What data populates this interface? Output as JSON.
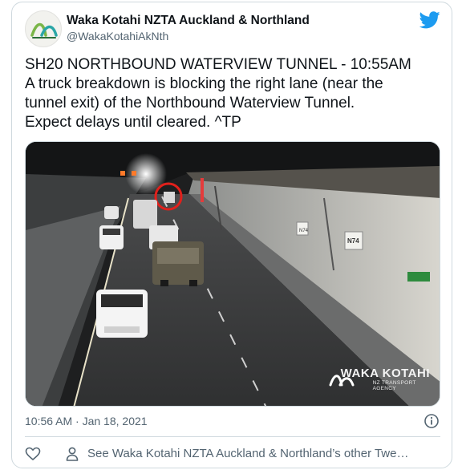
{
  "author": {
    "name": "Waka Kotahi NZTA Auckland & Northland",
    "handle": "@WakaKotahiAkNth",
    "avatar_icon": "waka-kotahi-logo"
  },
  "platform_icon": "twitter-bird-icon",
  "tweet": {
    "text_lines": [
      "SH20 NORTHBOUND WATERVIEW TUNNEL - 10:55AM",
      "A truck breakdown is blocking the right lane (near the",
      "tunnel exit) of the Northbound Waterview Tunnel.",
      "Expect delays until cleared. ^TP"
    ]
  },
  "media": {
    "watermark_main": "WAKA KOTAHI",
    "watermark_sub_1": "NZ TRANSPORT",
    "watermark_sub_2": "AGENCY",
    "sign_1": "N74",
    "sign_2": "N74"
  },
  "footer": {
    "timestamp": "10:56 AM · Jan 18, 2021",
    "info_icon": "info-icon",
    "like_icon": "heart-icon",
    "person_icon": "person-icon",
    "other_tweets_link": "See Waka Kotahi NZTA Auckland & Northland’s other Twe…"
  },
  "colors": {
    "twitter_blue": "#1d9bf0",
    "logo_green": "#7ab648",
    "logo_teal": "#2aa6a6",
    "highlight_circle": "#e0201b"
  }
}
